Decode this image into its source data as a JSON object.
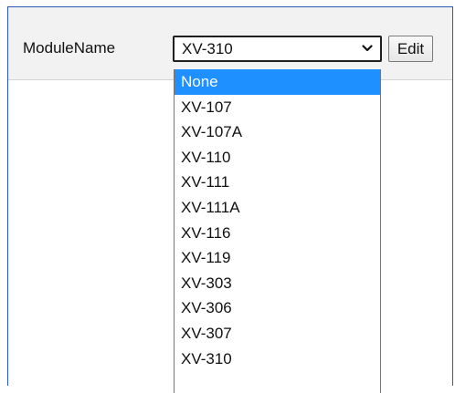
{
  "toolbar": {
    "label": "ModuleName",
    "selected_value": "XV-310",
    "edit_button": "Edit"
  },
  "dropdown": {
    "highlighted_option": "None",
    "options": [
      "None",
      "XV-107",
      "XV-107A",
      "XV-110",
      "XV-111",
      "XV-111A",
      "XV-116",
      "XV-119",
      "XV-303",
      "XV-306",
      "XV-307",
      "XV-310"
    ]
  },
  "colors": {
    "frame_border": "#2f57b7",
    "highlight": "#1e90ff",
    "toolbar_bg": "#f2f2f2"
  },
  "icons": {
    "select_arrow": "chevron-down-icon"
  }
}
